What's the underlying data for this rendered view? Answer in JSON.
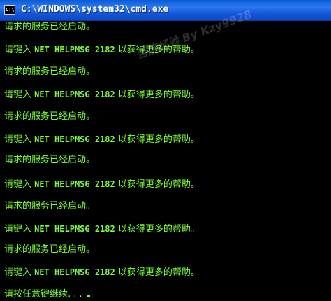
{
  "window": {
    "title": "C:\\WINDOWS\\system32\\cmd.exe",
    "icon_label": "C:\\"
  },
  "colors": {
    "console_text": "#7cff32",
    "console_bg": "#000000",
    "titlebar": "#1454d6"
  },
  "console": {
    "lines": [
      {
        "kind": "service",
        "text": "请求的服务已经启动。"
      },
      {
        "kind": "help",
        "prefix": "请键入 ",
        "code": "NET HELPMSG 2182",
        "suffix": " 以获得更多的帮助。"
      },
      {
        "kind": "service",
        "text": "请求的服务已经启动。"
      },
      {
        "kind": "help",
        "prefix": "请键入 ",
        "code": "NET HELPMSG 2182",
        "suffix": " 以获得更多的帮助。"
      },
      {
        "kind": "service",
        "text": "请求的服务已经启动。"
      },
      {
        "kind": "help",
        "prefix": "请键入 ",
        "code": "NET HELPMSG 2182",
        "suffix": " 以获得更多的帮助。"
      },
      {
        "kind": "service",
        "text": "请求的服务已经启动。"
      },
      {
        "kind": "help",
        "prefix": "请键入 ",
        "code": "NET HELPMSG 2182",
        "suffix": " 以获得更多的帮助。"
      },
      {
        "kind": "service",
        "text": "请求的服务已经启动。"
      },
      {
        "kind": "help",
        "prefix": "请键入 ",
        "code": "NET HELPMSG 2182",
        "suffix": " 以获得更多的帮助。"
      },
      {
        "kind": "service",
        "text": "请求的服务已经启动。"
      },
      {
        "kind": "help",
        "prefix": "请键入 ",
        "code": "NET HELPMSG 2182",
        "suffix": " 以获得更多的帮助。"
      },
      {
        "kind": "prompt",
        "text": "请按任意键继续. . . "
      }
    ]
  },
  "watermark": "百度经验 By Kzy9928"
}
